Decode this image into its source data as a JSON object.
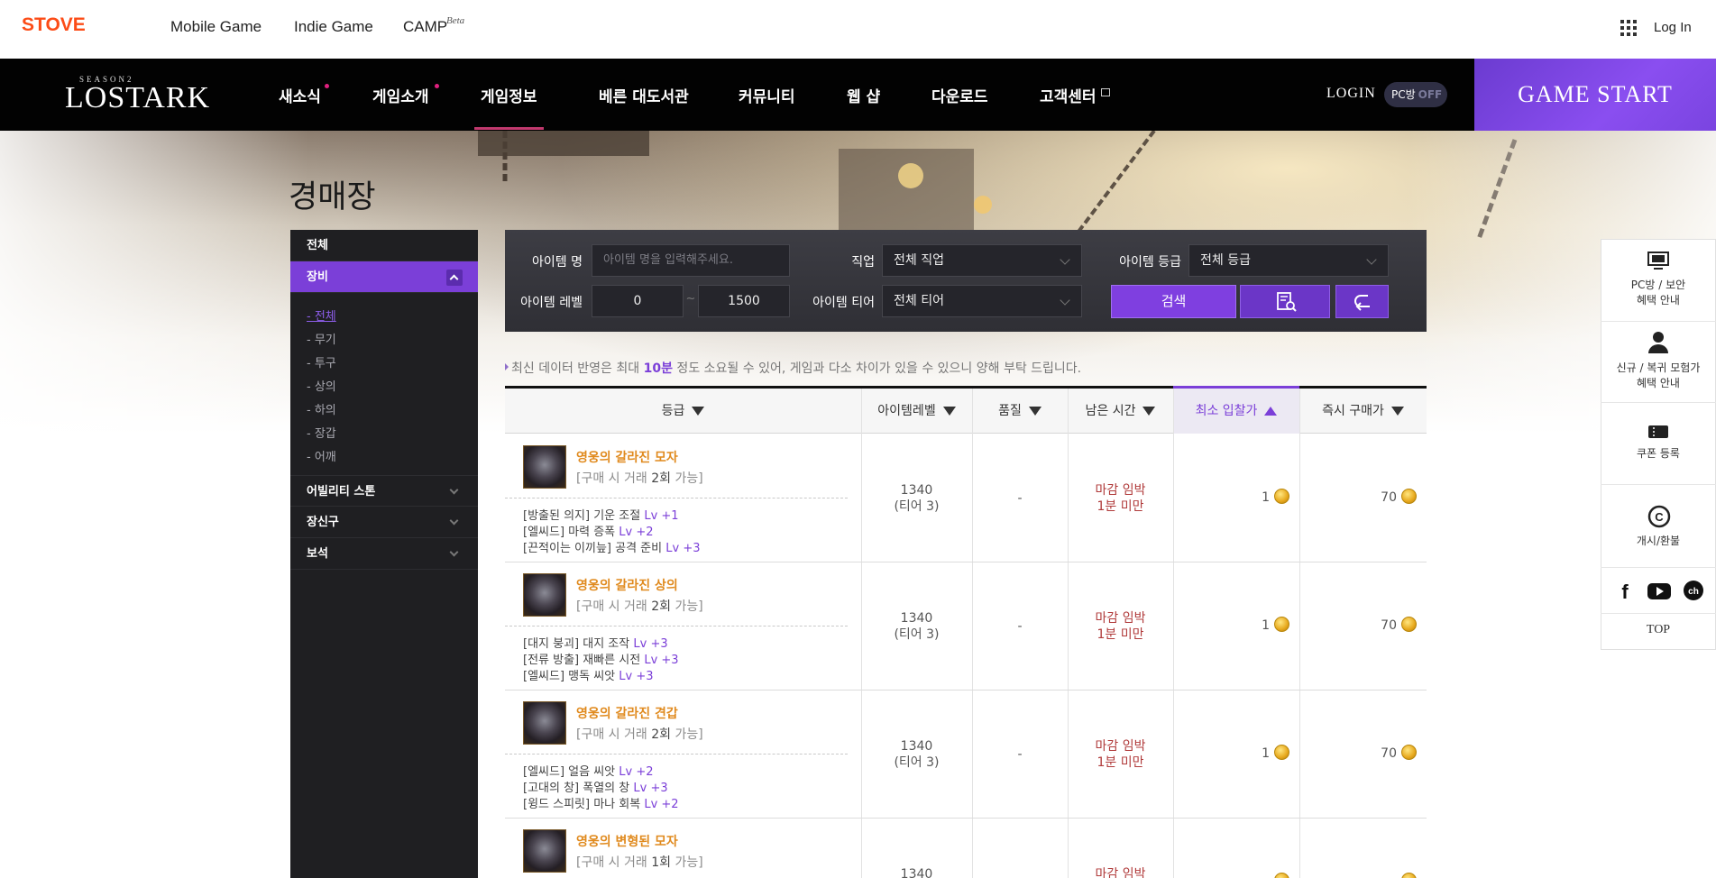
{
  "stove": {
    "logo": "STOVE",
    "links": [
      "Mobile Game",
      "Indie Game",
      "CAMP"
    ],
    "camp_badge": "Beta",
    "login": "Log In"
  },
  "game_nav": {
    "logo_season": "SEASON2",
    "logo_name": "LOSTARK",
    "items": [
      "새소식",
      "게임소개",
      "게임정보",
      "베른 대도서관",
      "커뮤니티",
      "웹 샵",
      "다운로드",
      "고객센터"
    ],
    "login": "LOGIN",
    "pcbang_label": "PC방",
    "pcbang_state": "OFF",
    "game_start": "GAME START",
    "active_item": "게임정보"
  },
  "page": {
    "title": "경매장"
  },
  "sidebar": {
    "top": "전체",
    "equipment": "장비",
    "equipment_subs": [
      "- 전체",
      "- 무기",
      "- 투구",
      "- 상의",
      "- 하의",
      "- 장갑",
      "- 어깨"
    ],
    "sections": [
      "어빌리티 스톤",
      "장신구",
      "보석"
    ]
  },
  "search": {
    "item_name_label": "아이템 명",
    "item_name_placeholder": "아이템 명을 입력해주세요.",
    "class_label": "직업",
    "class_value": "전체 직업",
    "grade_label": "아이템 등급",
    "grade_value": "전체 등급",
    "level_label": "아이템 레벨",
    "level_min": "0",
    "level_tilde": "~",
    "level_max": "1500",
    "tier_label": "아이템 티어",
    "tier_value": "전체 티어",
    "search_button": "검색"
  },
  "notice": {
    "before": "최신 데이터 반영은 최대 ",
    "highlight": "10분",
    "after": " 정도 소요될 수 있어, 게임과 다소 차이가 있을 수 있으니 양해 부탁 드립니다."
  },
  "table": {
    "headers": [
      "등급",
      "아이템레벨",
      "품질",
      "남은 시간",
      "최소 입찰가",
      "즉시 구매가"
    ],
    "rows": [
      {
        "name": "영웅의 갈라진 모자",
        "trade_pre": "[구매 시 거래 ",
        "trade_count": "2회",
        "trade_post": " 가능]",
        "engravings": [
          {
            "tag": "[방출된 의지]",
            "name": " 기운 조절 ",
            "lv": "Lv +1"
          },
          {
            "tag": "[엘씨드]",
            "name": " 마력 증폭 ",
            "lv": "Lv +2"
          },
          {
            "tag": "[끈적이는 이끼늪]",
            "name": " 공격 준비 ",
            "lv": "Lv +3"
          }
        ],
        "level": "1340",
        "tier": "(티어 3)",
        "quality": "-",
        "time1": "마감 임박",
        "time2": "1분 미만",
        "min_bid": "1",
        "buy_now": "70"
      },
      {
        "name": "영웅의 갈라진 상의",
        "trade_pre": "[구매 시 거래 ",
        "trade_count": "2회",
        "trade_post": " 가능]",
        "engravings": [
          {
            "tag": "[대지 붕괴]",
            "name": " 대지 조작 ",
            "lv": "Lv +3"
          },
          {
            "tag": "[전류 방출]",
            "name": " 재빠른 시전 ",
            "lv": "Lv +3"
          },
          {
            "tag": "[엘씨드]",
            "name": " 맹독 씨앗 ",
            "lv": "Lv +3"
          }
        ],
        "level": "1340",
        "tier": "(티어 3)",
        "quality": "-",
        "time1": "마감 임박",
        "time2": "1분 미만",
        "min_bid": "1",
        "buy_now": "70"
      },
      {
        "name": "영웅의 갈라진 견갑",
        "trade_pre": "[구매 시 거래 ",
        "trade_count": "2회",
        "trade_post": " 가능]",
        "engravings": [
          {
            "tag": "[엘씨드]",
            "name": " 얼음 씨앗 ",
            "lv": "Lv +2"
          },
          {
            "tag": "[고대의 창]",
            "name": " 폭열의 창 ",
            "lv": "Lv +3"
          },
          {
            "tag": "[윙드 스피릿]",
            "name": " 마나 회복 ",
            "lv": "Lv +2"
          }
        ],
        "level": "1340",
        "tier": "(티어 3)",
        "quality": "-",
        "time1": "마감 임박",
        "time2": "1분 미만",
        "min_bid": "1",
        "buy_now": "70"
      },
      {
        "name": "영웅의 변형된 모자",
        "trade_pre": "[구매 시 거래 ",
        "trade_count": "1회",
        "trade_post": " 가능]",
        "level": "1340",
        "time1": "마감 임박"
      }
    ]
  },
  "quick_menu": {
    "pcbang_line1": "PC방 / 보안",
    "pcbang_line2": "혜택 안내",
    "newbie_line1": "신규 / 복귀 모험가",
    "newbie_line2": "혜택 안내",
    "coupon": "쿠폰 등록",
    "cash": "개시/환불",
    "top": "TOP",
    "socials": [
      "facebook-icon",
      "youtube-icon",
      "channel-talk-icon"
    ]
  },
  "colors": {
    "accent": "#7b3fd8",
    "item_name": "#e08a1e",
    "stove": "#fc4c17",
    "deadline": "#b03a3a"
  }
}
